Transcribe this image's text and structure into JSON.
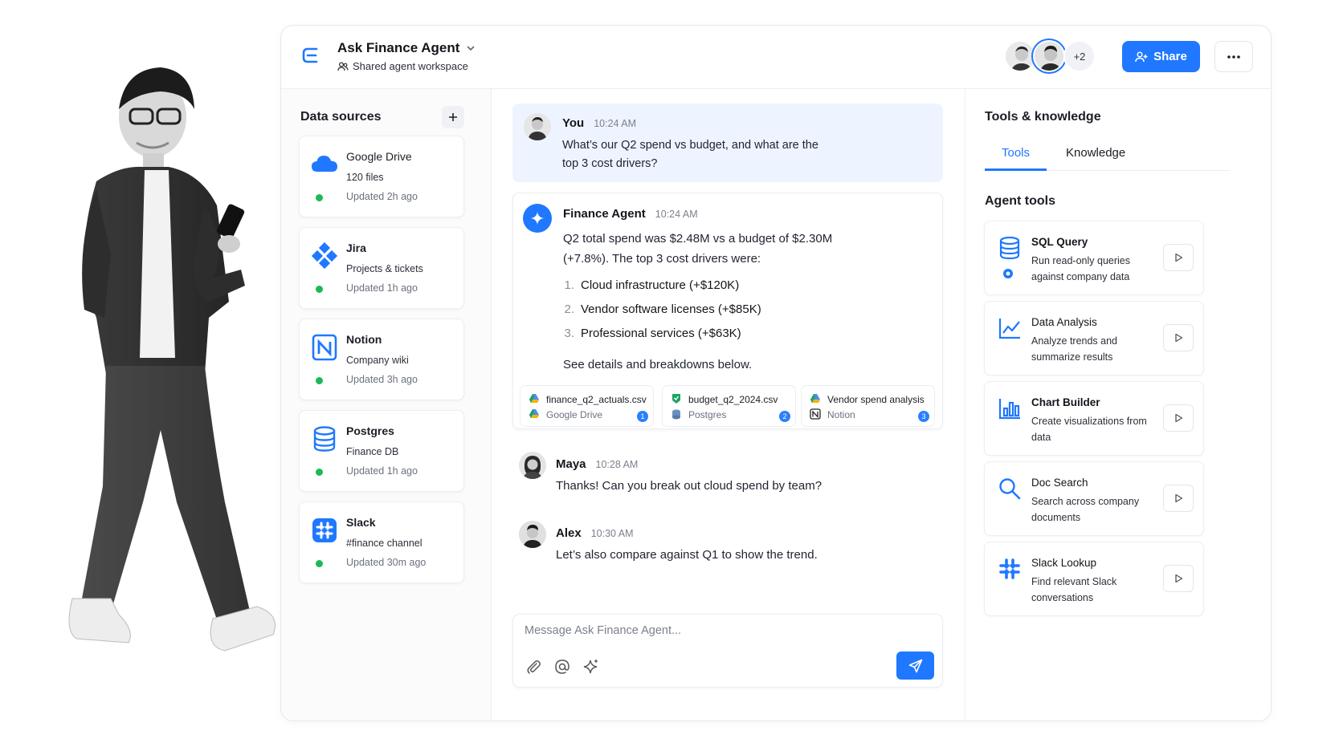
{
  "header": {
    "title": "Ask Finance Agent",
    "subtitle": "Shared agent workspace",
    "extra_members": "+2",
    "share_label": "Share"
  },
  "sources": {
    "title": "Data sources",
    "items": [
      {
        "name": "Google Drive",
        "sub": "120 files",
        "updated": "Updated 2h ago",
        "icon": "cloud-icon"
      },
      {
        "name": "Jira",
        "sub": "Projects & tickets",
        "updated": "Updated 1h ago",
        "icon": "jira-icon"
      },
      {
        "name": "Notion",
        "sub": "Company wiki",
        "updated": "Updated 3h ago",
        "icon": "notion-icon"
      },
      {
        "name": "Postgres",
        "sub": "Finance DB",
        "updated": "Updated 1h ago",
        "icon": "database-icon"
      },
      {
        "name": "Slack",
        "sub": "#finance channel",
        "updated": "Updated 30m ago",
        "icon": "slack-icon"
      }
    ]
  },
  "chat": {
    "user_msg": {
      "who": "You",
      "time": "10:24 AM",
      "text1": "What’s our Q2 spend vs budget, and what are the",
      "text2": "top 3 cost drivers?"
    },
    "agent_msg": {
      "who": "Finance Agent",
      "time": "10:24 AM",
      "text1": "Q2 total spend was $2.48M vs a budget of $2.30M",
      "text2": "(+7.8%). The top 3 cost drivers were:",
      "items": [
        "Cloud infrastructure (+$120K)",
        "Vendor software licenses (+$85K)",
        "Professional services (+$63K)"
      ],
      "numbers": [
        "1.",
        "2.",
        "3."
      ],
      "footer": "See details and breakdowns below.",
      "files": [
        {
          "name": "finance_q2_actuals.csv",
          "source": "Google Drive",
          "badge": "1"
        },
        {
          "name": "budget_q2_2024.csv",
          "source": "Postgres",
          "badge": "2"
        },
        {
          "name": "Vendor spend analysis",
          "source": "Notion",
          "badge": "3"
        }
      ]
    },
    "maya_msg": {
      "who": "Maya",
      "time": "10:28 AM",
      "text": "Thanks! Can you break out cloud spend by team?"
    },
    "alex_msg": {
      "who": "Alex",
      "time": "10:30 AM",
      "text": "Let’s also compare against Q1 to show the trend."
    },
    "composer_placeholder": "Message Ask Finance Agent..."
  },
  "panel": {
    "title": "Tools & knowledge",
    "tabs": [
      "Tools",
      "Knowledge"
    ],
    "section": "Agent tools",
    "tools": [
      {
        "name": "SQL Query",
        "desc": "Run read-only queries against company data",
        "icon": "database-icon"
      },
      {
        "name": "Data Analysis",
        "desc": "Analyze trends and summarize results",
        "icon": "line-chart-icon"
      },
      {
        "name": "Chart Builder",
        "desc": "Create visualizations from data",
        "icon": "bar-chart-icon"
      },
      {
        "name": "Doc Search",
        "desc": "Search across company documents",
        "icon": "search-icon"
      },
      {
        "name": "Slack Lookup",
        "desc": "Find relevant Slack conversations",
        "icon": "slack-icon"
      }
    ]
  },
  "colors": {
    "accent": "#1f78ff",
    "online": "#1db954",
    "user_bubble": "#eef4ff"
  }
}
